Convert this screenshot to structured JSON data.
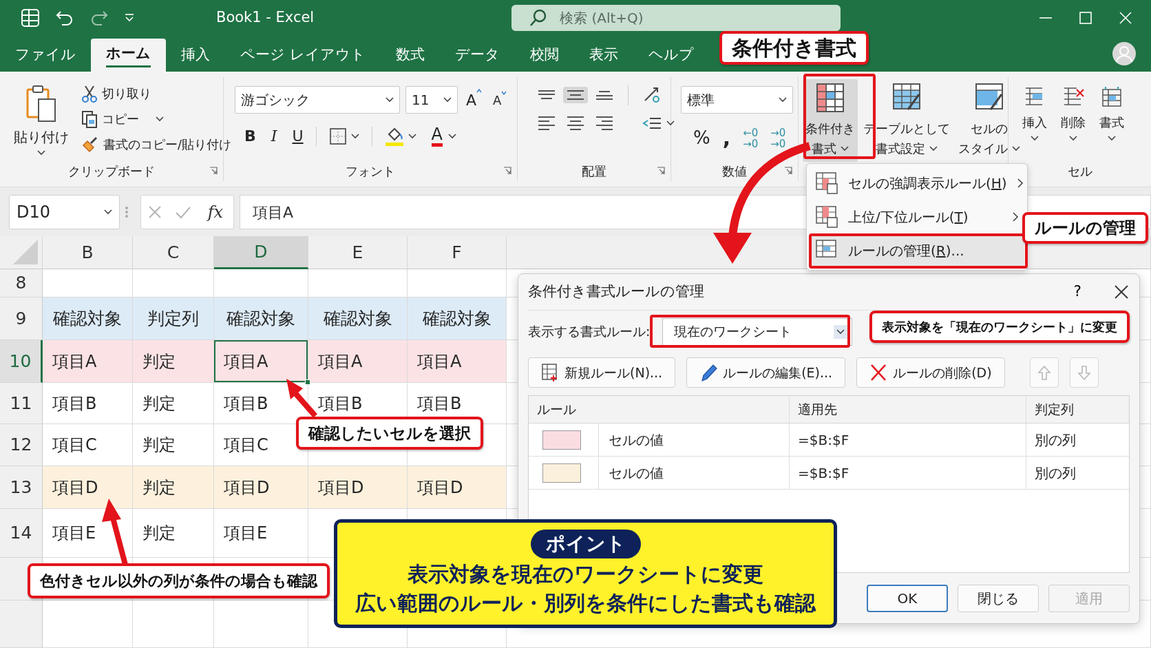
{
  "title_bar": {
    "title": "Book1  -  Excel",
    "search_placeholder": "検索 (Alt+Q)"
  },
  "menu_tabs": [
    {
      "label": "ファイル",
      "selected": false
    },
    {
      "label": "ホーム",
      "selected": true
    },
    {
      "label": "挿入",
      "selected": false
    },
    {
      "label": "ページ レイアウト",
      "selected": false
    },
    {
      "label": "数式",
      "selected": false
    },
    {
      "label": "データ",
      "selected": false
    },
    {
      "label": "校閲",
      "selected": false
    },
    {
      "label": "表示",
      "selected": false
    },
    {
      "label": "ヘルプ",
      "selected": false
    }
  ],
  "ribbon": {
    "clipboard": {
      "label": "クリップボード",
      "paste": "貼り付け",
      "cut": "切り取り",
      "copy": "コピー",
      "format_painter": "書式のコピー/貼り付け"
    },
    "font": {
      "label": "フォント",
      "font_name": "游ゴシック",
      "font_size": "11",
      "grow": "A",
      "shrink": "A",
      "bold": "B",
      "italic": "I",
      "underline": "U",
      "font_color": "A"
    },
    "alignment": {
      "label": "配置",
      "vertical": [
        {
          "kind": "top",
          "selected": false
        },
        {
          "kind": "middle",
          "selected": true
        },
        {
          "kind": "bottom",
          "selected": false
        }
      ],
      "horizontal": [
        {
          "kind": "left",
          "selected": false
        },
        {
          "kind": "center",
          "selected": false
        },
        {
          "kind": "right",
          "selected": false
        }
      ]
    },
    "number": {
      "label": "数値",
      "format": "標準",
      "percent": "%",
      "comma": ",",
      "decimal_increase": [
        "←0",
        "→0"
      ],
      "decimal_decrease": [
        "→0",
        "→0"
      ]
    },
    "styles": {
      "buttons": [
        {
          "lines": [
            "条件付き",
            "書式"
          ],
          "expanded": true
        },
        {
          "lines": [
            "テーブルとして",
            "書式設定"
          ],
          "expanded": false
        },
        {
          "lines": [
            "セルの",
            "スタイル"
          ],
          "expanded": false
        }
      ]
    },
    "cells": {
      "label": "セル",
      "buttons": [
        {
          "label": "挿入",
          "kind": "insert"
        },
        {
          "label": "削除",
          "kind": "delete"
        },
        {
          "label": "書式",
          "kind": "format"
        }
      ]
    }
  },
  "formula_bar": {
    "name_box": "D10",
    "fx": "fx",
    "formula": "項目A"
  },
  "sheet": {
    "columns": [
      {
        "label": "B",
        "selected": false
      },
      {
        "label": "C",
        "selected": false
      },
      {
        "label": "D",
        "selected": true
      },
      {
        "label": "E",
        "selected": false
      },
      {
        "label": "F",
        "selected": false
      }
    ],
    "rows": [
      {
        "number": "8",
        "selected": false,
        "cells": []
      },
      {
        "number": "9",
        "selected": false,
        "kind": "header",
        "color": "#ddebf7",
        "cells": [
          "確認対象",
          "判定列",
          "確認対象",
          "確認対象",
          "確認対象"
        ]
      },
      {
        "number": "10",
        "selected": true,
        "kind": "data",
        "color": "#fbe2e4",
        "cells": [
          "項目A",
          "判定",
          "項目A",
          "項目A",
          "項目A"
        ]
      },
      {
        "number": "11",
        "selected": false,
        "kind": "data",
        "color": "#ffffff",
        "cells": [
          "項目B",
          "判定",
          "項目B",
          "項目B",
          "項目B"
        ]
      },
      {
        "number": "12",
        "selected": false,
        "kind": "data",
        "color": "#ffffff",
        "cells": [
          "項目C",
          "判定",
          "項目C"
        ]
      },
      {
        "number": "13",
        "selected": false,
        "kind": "data",
        "color": "#fdf1dd",
        "cells": [
          "項目D",
          "判定",
          "項目D",
          "項目D",
          "項目D"
        ]
      },
      {
        "number": "14",
        "selected": false,
        "kind": "data",
        "color": "#ffffff",
        "cells": [
          "項目E",
          "判定",
          "項目E"
        ]
      }
    ]
  },
  "format_menu": {
    "items": [
      {
        "label": "セルの強調表示ルール(",
        "key": "H",
        "tail": ")",
        "submenu": true,
        "selected": false
      },
      {
        "label": "上位/下位ルール(",
        "key": "T",
        "tail": ")",
        "submenu": true,
        "selected": false
      },
      {
        "label": "ルールの管理(",
        "key": "R",
        "tail": ")...",
        "submenu": false,
        "selected": true
      }
    ]
  },
  "dialog": {
    "title": "条件付き書式ルールの管理",
    "help": "?",
    "scope_label": "表示する書式ルール:",
    "scope_value": "現在のワークシート",
    "actions": [
      {
        "label": "新規ルール(N)...",
        "kind": "new"
      },
      {
        "label": "ルールの編集(E)...",
        "kind": "edit"
      },
      {
        "label": "ルールの削除(D)",
        "kind": "delete"
      }
    ],
    "move_buttons": [
      {
        "kind": "up",
        "disabled": true
      },
      {
        "kind": "down",
        "disabled": true
      }
    ],
    "columns": [
      "ルール",
      "適用先",
      "判定列"
    ],
    "rules": [
      {
        "color": "#f9dde1",
        "rule": "セルの値",
        "applies_to": "=$B:$F",
        "judge": "別の列"
      },
      {
        "color": "#faf0dc",
        "rule": "セルの値",
        "applies_to": "=$B:$F",
        "judge": "別の列"
      }
    ],
    "footer": [
      {
        "label": "OK",
        "kind": "default",
        "disabled": false
      },
      {
        "label": "閉じる",
        "kind": "normal",
        "disabled": false
      },
      {
        "label": "適用",
        "kind": "normal",
        "disabled": true
      }
    ]
  },
  "callouts": [
    {
      "text": "条件付き書式"
    },
    {
      "text": "ルールの管理"
    },
    {
      "text": "表示対象を「現在のワークシート」に変更"
    },
    {
      "text": "確認したいセルを選択"
    },
    {
      "text": "色付きセル以外の列が条件の場合も確認"
    }
  ],
  "point": {
    "badge": "ポイント",
    "lines": [
      "表示対象を現在のワークシートに変更",
      "広い範囲のルール・別列を条件にした書式も確認"
    ]
  }
}
